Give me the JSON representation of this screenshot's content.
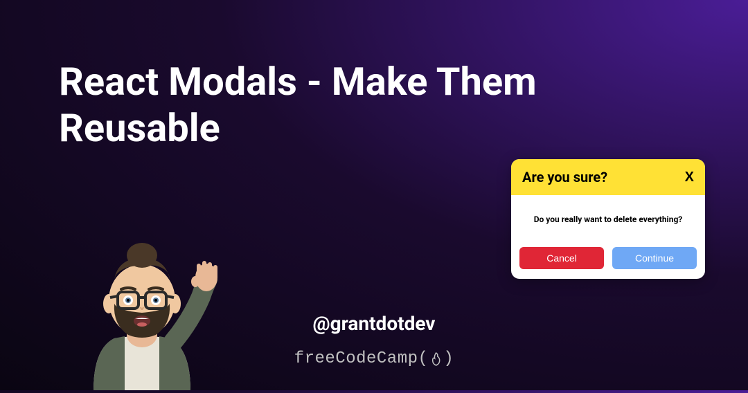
{
  "title": "React Modals - Make Them Reusable",
  "handle": "@grantdotdev",
  "fcc": {
    "prefix": "freeCodeCamp(",
    "suffix": ")"
  },
  "modal": {
    "title": "Are you sure?",
    "close": "X",
    "body": "Do you really want to delete everything?",
    "cancel": "Cancel",
    "continue": "Continue"
  }
}
